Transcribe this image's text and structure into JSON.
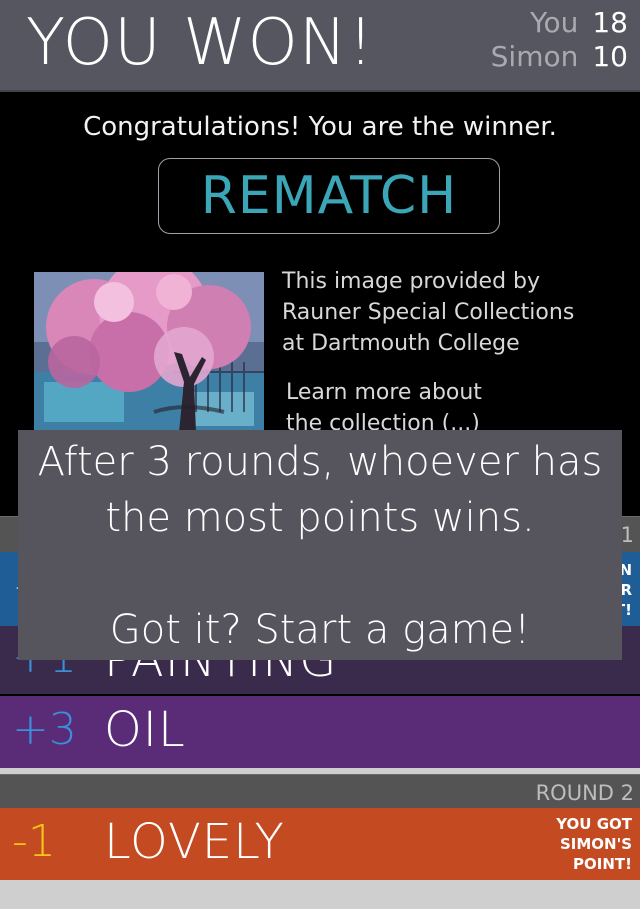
{
  "header": {
    "title": "YOU WON!",
    "scores": [
      {
        "name": "You",
        "score": "18"
      },
      {
        "name": "Simon",
        "score": "10"
      }
    ]
  },
  "main": {
    "congrats": "Congratulations! You are the winner.",
    "rematch_label": "REMATCH",
    "credit_lines": [
      "This image provided by",
      "Rauner Special Collections",
      "at Dartmouth College"
    ],
    "learn_lines": [
      "Learn more about",
      "the collection (...)"
    ]
  },
  "rounds": {
    "round1_label_partial": "1",
    "round2_label": "ROUND 2"
  },
  "rows": {
    "blue": {
      "pts": "+",
      "note_partial": [
        "N",
        "R",
        "T!"
      ]
    },
    "painting": {
      "pts": "+1",
      "word": "PAINTING"
    },
    "oil": {
      "pts": "+3",
      "word": "OIL"
    },
    "lovely": {
      "pts": "-1",
      "word": "LOVELY",
      "note": [
        "YOU GOT",
        "SIMON'S",
        "POINT!"
      ]
    }
  },
  "tutorial": {
    "line1": "After 3 rounds, whoever has",
    "line2": "the most points wins.",
    "line3": "Got it? Start a game!"
  },
  "colors": {
    "accent_teal": "#3aa6b7",
    "points_blue": "#3b8fd8",
    "points_yellow": "#f5c518"
  }
}
